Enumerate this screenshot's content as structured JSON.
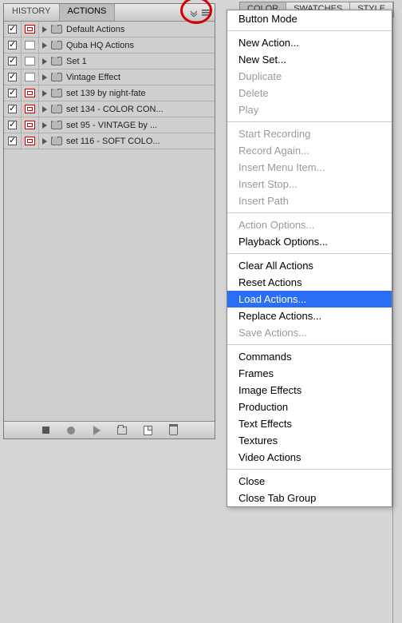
{
  "tabs": {
    "history": "HISTORY",
    "actions": "ACTIONS"
  },
  "list": [
    {
      "label": "Default Actions",
      "mode": true
    },
    {
      "label": "Quba HQ Actions",
      "mode": false
    },
    {
      "label": "Set 1",
      "mode": false
    },
    {
      "label": "Vintage Effect",
      "mode": false
    },
    {
      "label": "set 139 by night-fate",
      "mode": true
    },
    {
      "label": "set 134 - COLOR CON...",
      "mode": true
    },
    {
      "label": "set 95 - VINTAGE  by ...",
      "mode": true
    },
    {
      "label": "set 116 - SOFT COLO...",
      "mode": true
    }
  ],
  "right_tabs": {
    "color": "COLOR",
    "swatches": "SWATCHES",
    "styles": "STYLE"
  },
  "menu": {
    "g1": [
      "Button Mode"
    ],
    "g2": [
      {
        "t": "New Action...",
        "d": false
      },
      {
        "t": "New Set...",
        "d": false
      },
      {
        "t": "Duplicate",
        "d": true
      },
      {
        "t": "Delete",
        "d": true
      },
      {
        "t": "Play",
        "d": true
      }
    ],
    "g3": [
      {
        "t": "Start Recording",
        "d": true
      },
      {
        "t": "Record Again...",
        "d": true
      },
      {
        "t": "Insert Menu Item...",
        "d": true
      },
      {
        "t": "Insert Stop...",
        "d": true
      },
      {
        "t": "Insert Path",
        "d": true
      }
    ],
    "g4": [
      {
        "t": "Action Options...",
        "d": true
      },
      {
        "t": "Playback Options...",
        "d": false
      }
    ],
    "g5": [
      {
        "t": "Clear All Actions",
        "d": false
      },
      {
        "t": "Reset Actions",
        "d": false
      },
      {
        "t": "Load Actions...",
        "d": false,
        "hl": true
      },
      {
        "t": "Replace Actions...",
        "d": false
      },
      {
        "t": "Save Actions...",
        "d": true
      }
    ],
    "g6": [
      {
        "t": "Commands",
        "d": false
      },
      {
        "t": "Frames",
        "d": false
      },
      {
        "t": "Image Effects",
        "d": false
      },
      {
        "t": "Production",
        "d": false
      },
      {
        "t": "Text Effects",
        "d": false
      },
      {
        "t": "Textures",
        "d": false
      },
      {
        "t": "Video Actions",
        "d": false
      }
    ],
    "g7": [
      {
        "t": "Close",
        "d": false
      },
      {
        "t": "Close Tab Group",
        "d": false
      }
    ]
  }
}
